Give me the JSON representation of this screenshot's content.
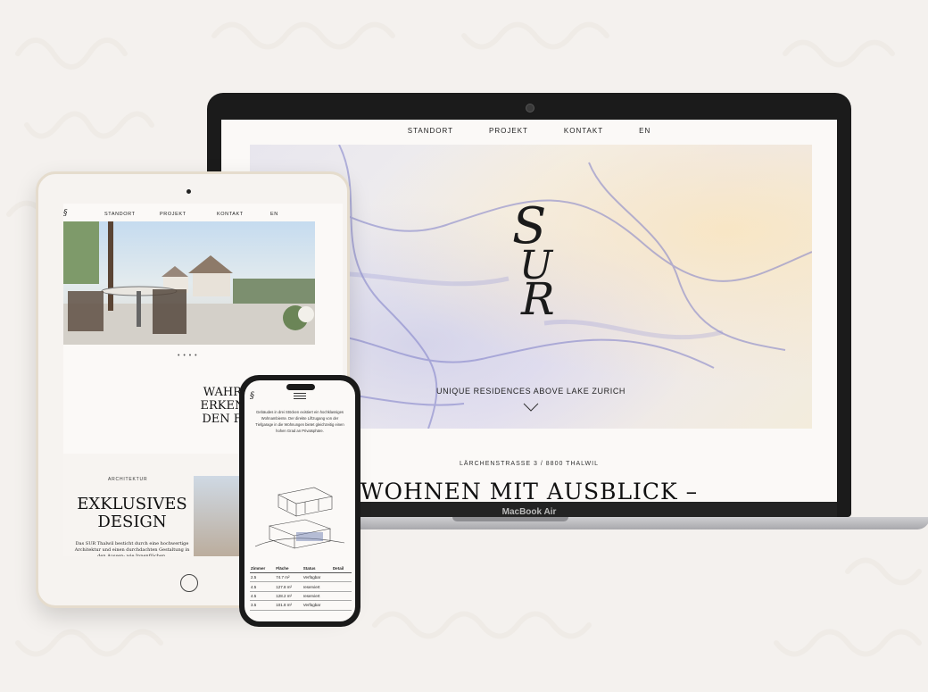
{
  "laptop": {
    "nav": [
      "STANDORT",
      "PROJEKT",
      "KONTAKT",
      "EN"
    ],
    "hero_logo": "SUR",
    "hero_subtitle": "UNIQUE RESIDENCES ABOVE LAKE ZURICH",
    "address": "LÄRCHENSTRASSE 3 / 8800 THALWIL",
    "headline": "WOHNEN MIT AUSBLICK –",
    "device_label": "MacBook Air"
  },
  "tablet": {
    "nav": [
      "STANDORT",
      "PROJEKT",
      "KONTAKT",
      "EN"
    ],
    "carousel_dots": "• • • •",
    "quote_lines": [
      "WAHRE QUALITÄT",
      "ERKENNT MAN AN",
      "DEN FEINHEITEN."
    ],
    "section_label": "ARCHITEKTUR",
    "section_title_lines": [
      "EXKLUSIVES",
      "DESIGN"
    ],
    "section_body": "Das SUR Thalwil besticht durch eine hochwertige Architektur und einen durchdachten Gestaltung in den Aussen- wie Innenflächen."
  },
  "phone": {
    "body_text": "Gebäudes in drei Stöcken existiert ein hochklassiges Wohnambiente. Der direkte Liftzugang von der Tiefgarage in die Wohnungen bietet gleichzeitig einen hohen Grad an Privatsphäre.",
    "table": {
      "headers": [
        "Zimmer",
        "Fläche",
        "Status",
        "Detail"
      ],
      "rows": [
        [
          "2.5",
          "74.7 m²",
          "Verfügbar",
          ""
        ],
        [
          "4.5",
          "127.8 m²",
          "reserviert",
          ""
        ],
        [
          "4.5",
          "128.2 m²",
          "reserviert",
          ""
        ],
        [
          "3.5",
          "101.8 m²",
          "Verfügbar",
          ""
        ]
      ]
    }
  },
  "colors": {
    "background": "#f4f1ee",
    "device_dark": "#1b1b1b",
    "text": "#111111"
  }
}
